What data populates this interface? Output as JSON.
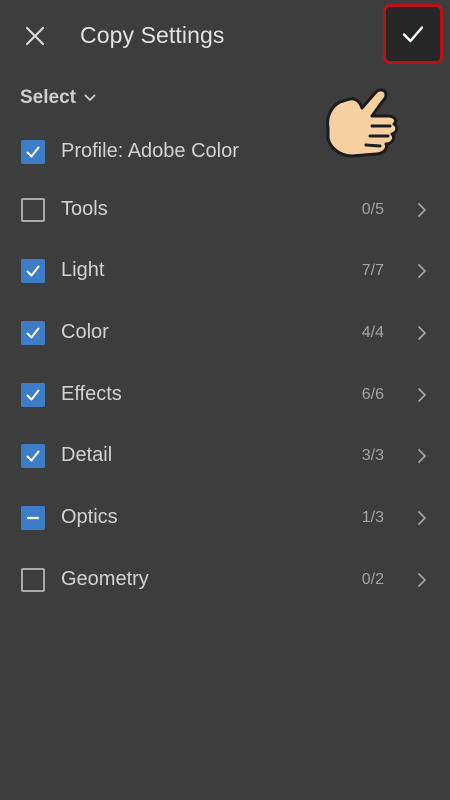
{
  "header": {
    "title": "Copy Settings",
    "close_icon": "close-icon",
    "confirm_icon": "checkmark-icon",
    "confirm_highlight_color": "#b8121b"
  },
  "select_menu": {
    "label": "Select",
    "icon": "chevron-down-icon"
  },
  "accent_color": "#3f7cc7",
  "settings": [
    {
      "label": "Profile: Adobe Color",
      "state": "checked",
      "count": ""
    },
    {
      "label": "Tools",
      "state": "unchecked",
      "count": "0/5"
    },
    {
      "label": "Light",
      "state": "checked",
      "count": "7/7"
    },
    {
      "label": "Color",
      "state": "checked",
      "count": "4/4"
    },
    {
      "label": "Effects",
      "state": "checked",
      "count": "6/6"
    },
    {
      "label": "Detail",
      "state": "checked",
      "count": "3/3"
    },
    {
      "label": "Optics",
      "state": "partial",
      "count": "1/3"
    },
    {
      "label": "Geometry",
      "state": "unchecked",
      "count": "0/2"
    }
  ],
  "overlay": {
    "icon": "pointing-hand-icon"
  }
}
